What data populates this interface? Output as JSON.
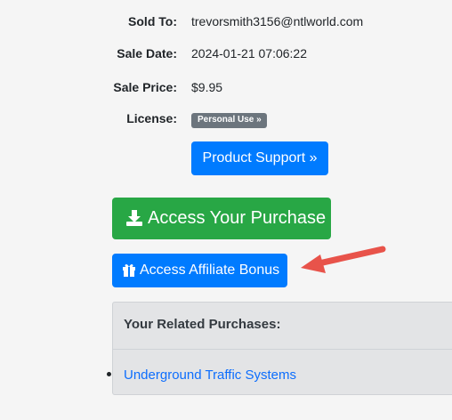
{
  "details": {
    "sold_to_label": "Sold To:",
    "sold_to_value": "trevorsmith3156@ntlworld.com",
    "sale_date_label": "Sale Date:",
    "sale_date_value": "2024-01-21 07:06:22",
    "sale_price_label": "Sale Price:",
    "sale_price_value": "$9.95",
    "license_label": "License:",
    "license_badge": "Personal Use »"
  },
  "buttons": {
    "product_support": "Product Support »",
    "access_purchase": "Access Your Purchase",
    "affiliate_bonus": "Access Affiliate Bonus"
  },
  "icons": {
    "download": "download-icon",
    "gift": "gift-icon",
    "arrow": "red-arrow-annotation"
  },
  "related": {
    "title": "Your Related Purchases:",
    "items": [
      "Underground Traffic Systems"
    ]
  },
  "colors": {
    "primary": "#007bff",
    "success": "#28a745",
    "badge": "#6c757d",
    "arrow": "#e8534a",
    "link": "#0d6efd"
  }
}
